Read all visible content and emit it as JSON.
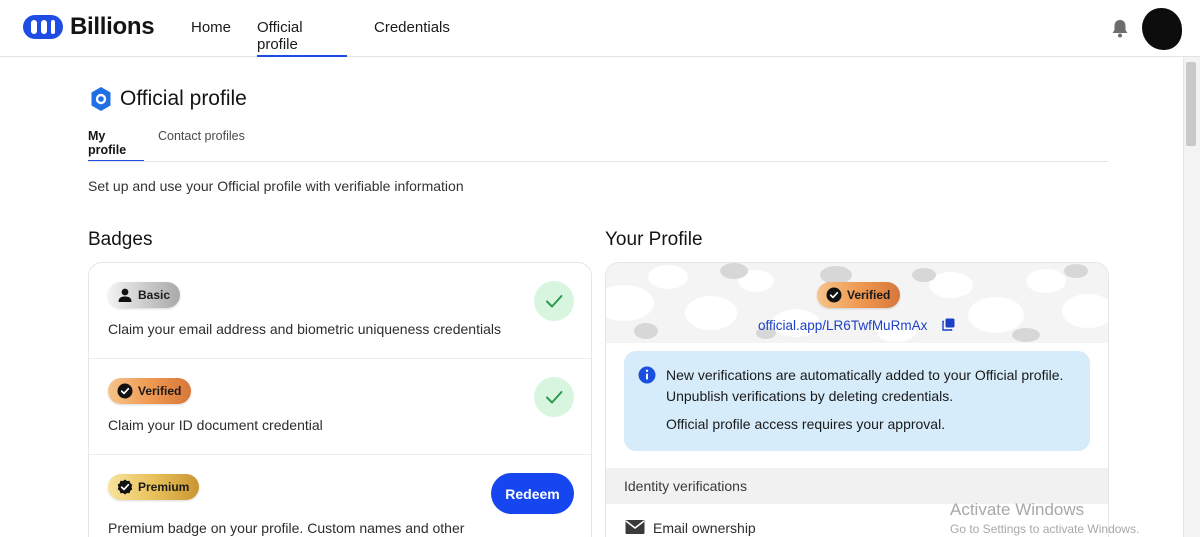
{
  "brand": {
    "name": "Billions",
    "accent": "#1f4de4",
    "button": "#1546f0"
  },
  "nav": {
    "items": [
      {
        "label": "Home"
      },
      {
        "label": "Official profile"
      },
      {
        "label": "Credentials"
      }
    ],
    "active": "Official profile"
  },
  "page": {
    "title": "Official profile",
    "tabs": [
      {
        "label": "My profile"
      },
      {
        "label": "Contact profiles"
      }
    ],
    "active_tab": "My profile",
    "intro": "Set up and use your Official profile with verifiable information"
  },
  "badges": {
    "title": "Badges",
    "items": [
      {
        "label": "Basic",
        "icon": "person-icon",
        "description": "Claim your email address and biometric uniqueness credentials",
        "status": "completed"
      },
      {
        "label": "Verified",
        "icon": "check-seal-icon",
        "description": "Claim your ID document credential",
        "status": "completed"
      },
      {
        "label": "Premium",
        "icon": "check-seal-icon",
        "description": "Premium badge on your profile. Custom names and other",
        "action": "Redeem"
      }
    ]
  },
  "profile": {
    "title": "Your Profile",
    "badge": "Verified",
    "link": "official.app/LR6TwfMuRmAx",
    "info": {
      "line1": "New verifications are automatically added to your Official profile.",
      "line2": "Unpublish verifications by deleting credentials.",
      "line3": "Official profile access requires your approval."
    },
    "section": "Identity verifications",
    "verifications": [
      {
        "label": "Email ownership",
        "icon": "envelope-icon"
      }
    ]
  },
  "watermark": {
    "line1": "Activate Windows",
    "line2": "Go to Settings to activate Windows."
  }
}
